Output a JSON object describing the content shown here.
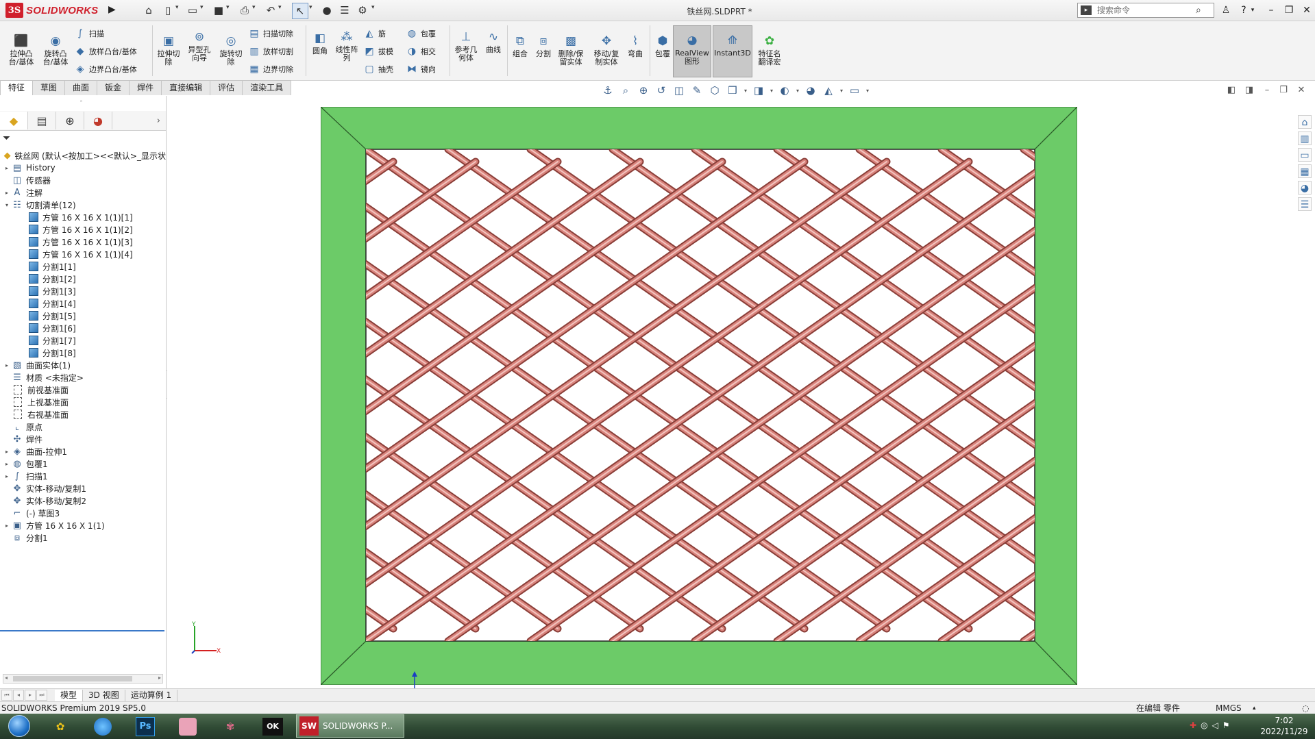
{
  "app": {
    "brand": "SOLIDWORKS",
    "document_title": "铁丝网.SLDPRT *",
    "search_placeholder": "搜索命令"
  },
  "command_manager": {
    "large_tools": [
      {
        "name": "extrude-boss-tool",
        "label": "拉伸凸\n台/基体",
        "icon": "extrude-boss-icon"
      },
      {
        "name": "revolve-boss-tool",
        "label": "旋转凸\n台/基体",
        "icon": "revolve-boss-icon"
      },
      {
        "name": "extrude-cut-tool",
        "label": "拉伸切\n除",
        "icon": "extrude-cut-icon"
      },
      {
        "name": "hole-wizard-tool",
        "label": "异型孔\n向导",
        "icon": "hole-wizard-icon"
      },
      {
        "name": "revolve-cut-tool",
        "label": "旋转切\n除",
        "icon": "revolve-cut-icon"
      },
      {
        "name": "fillet-tool",
        "label": "圆角",
        "icon": "fillet-icon"
      },
      {
        "name": "linear-pattern-tool",
        "label": "线性阵\n列",
        "icon": "linear-pattern-icon"
      },
      {
        "name": "reference-geometry-tool",
        "label": "参考几\n何体",
        "icon": "reference-geometry-icon"
      },
      {
        "name": "curves-tool",
        "label": "曲线",
        "icon": "curves-icon"
      },
      {
        "name": "combine-tool",
        "label": "组合",
        "icon": "combine-icon"
      },
      {
        "name": "split-tool",
        "label": "分割",
        "icon": "split-icon"
      },
      {
        "name": "delete-keep-body-tool",
        "label": "删除/保\n留实体",
        "icon": "delete-body-icon"
      },
      {
        "name": "move-copy-body-tool",
        "label": "移动/复\n制实体",
        "icon": "move-copy-icon"
      },
      {
        "name": "flex-tool",
        "label": "弯曲",
        "icon": "flex-icon"
      },
      {
        "name": "wrap-large-tool",
        "label": "包覆",
        "icon": "wrap-icon"
      },
      {
        "name": "realview-tool",
        "label": "RealView\n图形",
        "icon": "realview-icon"
      },
      {
        "name": "instant3d-tool",
        "label": "Instant3D",
        "icon": "instant3d-icon"
      },
      {
        "name": "feature-translate-tool",
        "label": "特征名\n翻译宏",
        "icon": "translate-icon"
      }
    ],
    "small_tools": [
      {
        "name": "sweep-tool",
        "label": "扫描",
        "icon": "sweep-icon"
      },
      {
        "name": "loft-tool",
        "label": "放样凸台/基体",
        "icon": "loft-icon"
      },
      {
        "name": "boundary-boss-tool",
        "label": "边界凸台/基体",
        "icon": "boundary-icon"
      },
      {
        "name": "swept-cut-tool",
        "label": "扫描切除",
        "icon": "swept-cut-icon"
      },
      {
        "name": "lofted-cut-tool",
        "label": "放样切割",
        "icon": "lofted-cut-icon"
      },
      {
        "name": "boundary-cut-tool",
        "label": "边界切除",
        "icon": "boundary-cut-icon"
      },
      {
        "name": "rib-tool",
        "label": "筋",
        "icon": "rib-icon"
      },
      {
        "name": "draft-tool",
        "label": "拔模",
        "icon": "draft-icon"
      },
      {
        "name": "shell-tool",
        "label": "抽壳",
        "icon": "shell-icon"
      },
      {
        "name": "wrap-tool",
        "label": "包覆",
        "icon": "wrap-icon"
      },
      {
        "name": "intersect-tool",
        "label": "相交",
        "icon": "intersect-icon"
      },
      {
        "name": "mirror-tool",
        "label": "镜向",
        "icon": "mirror-icon"
      }
    ]
  },
  "tabs": [
    "特征",
    "草图",
    "曲面",
    "钣金",
    "焊件",
    "直接编辑",
    "评估",
    "渲染工具"
  ],
  "tree": {
    "root": "铁丝网 (默认<按加工><<默认>_显示状",
    "items": [
      {
        "label": "History",
        "icon": "history-icon",
        "expand": "▸",
        "indent": 0
      },
      {
        "label": "传感器",
        "icon": "sensor-icon",
        "expand": "",
        "indent": 0
      },
      {
        "label": "注解",
        "icon": "annotation-icon",
        "expand": "▸",
        "indent": 0
      },
      {
        "label": "切割清单(12)",
        "icon": "cut-list-icon",
        "expand": "▾",
        "indent": 0
      },
      {
        "label": "方管 16 X 16 X 1(1)[1]",
        "icon": "body-icon",
        "expand": "",
        "indent": 1
      },
      {
        "label": "方管 16 X 16 X 1(1)[2]",
        "icon": "body-icon",
        "expand": "",
        "indent": 1
      },
      {
        "label": "方管 16 X 16 X 1(1)[3]",
        "icon": "body-icon",
        "expand": "",
        "indent": 1
      },
      {
        "label": "方管 16 X 16 X 1(1)[4]",
        "icon": "body-icon",
        "expand": "",
        "indent": 1
      },
      {
        "label": "分割1[1]",
        "icon": "body-icon",
        "expand": "",
        "indent": 1
      },
      {
        "label": "分割1[2]",
        "icon": "body-icon",
        "expand": "",
        "indent": 1
      },
      {
        "label": "分割1[3]",
        "icon": "body-icon",
        "expand": "",
        "indent": 1
      },
      {
        "label": "分割1[4]",
        "icon": "body-icon",
        "expand": "",
        "indent": 1
      },
      {
        "label": "分割1[5]",
        "icon": "body-icon",
        "expand": "",
        "indent": 1
      },
      {
        "label": "分割1[6]",
        "icon": "body-icon",
        "expand": "",
        "indent": 1
      },
      {
        "label": "分割1[7]",
        "icon": "body-icon",
        "expand": "",
        "indent": 1
      },
      {
        "label": "分割1[8]",
        "icon": "body-icon",
        "expand": "",
        "indent": 1
      },
      {
        "label": "曲面实体(1)",
        "icon": "surface-body-icon",
        "expand": "▸",
        "indent": 0
      },
      {
        "label": "材质 <未指定>",
        "icon": "material-icon",
        "expand": "",
        "indent": 0
      },
      {
        "label": "前视基准面",
        "icon": "plane-icon",
        "expand": "",
        "indent": 0
      },
      {
        "label": "上视基准面",
        "icon": "plane-icon",
        "expand": "",
        "indent": 0
      },
      {
        "label": "右视基准面",
        "icon": "plane-icon",
        "expand": "",
        "indent": 0
      },
      {
        "label": "原点",
        "icon": "origin-icon",
        "expand": "",
        "indent": 0
      },
      {
        "label": "焊件",
        "icon": "weldment-icon",
        "expand": "",
        "indent": 0
      },
      {
        "label": "曲面-拉伸1",
        "icon": "surface-extrude-icon",
        "expand": "▸",
        "indent": 0
      },
      {
        "label": "包覆1",
        "icon": "wrap-icon",
        "expand": "▸",
        "indent": 0
      },
      {
        "label": "扫描1",
        "icon": "sweep-icon",
        "expand": "▸",
        "indent": 0
      },
      {
        "label": "实体-移动/复制1",
        "icon": "move-copy-icon",
        "expand": "",
        "indent": 0
      },
      {
        "label": "实体-移动/复制2",
        "icon": "move-copy-icon",
        "expand": "",
        "indent": 0
      },
      {
        "label": "(-) 草图3",
        "icon": "sketch-icon",
        "expand": "",
        "indent": 0
      },
      {
        "label": "方管 16 X 16 X 1(1)",
        "icon": "structural-member-icon",
        "expand": "▸",
        "indent": 0
      },
      {
        "label": "分割1",
        "icon": "split-icon",
        "expand": "",
        "indent": 0
      }
    ]
  },
  "bottom_tabs": [
    "模型",
    "3D 视图",
    "运动算例 1"
  ],
  "status": {
    "product": "SOLIDWORKS Premium 2019 SP5.0",
    "editing": "在编辑 零件",
    "units": "MMGS"
  },
  "taskbar": {
    "active_task": "SOLIDWORKS P...",
    "time": "7:02",
    "date": "2022/11/29"
  },
  "colors": {
    "frame_green": "#6ccb68",
    "wire_pink": "#d9837c",
    "brand_red": "#d0202c"
  }
}
